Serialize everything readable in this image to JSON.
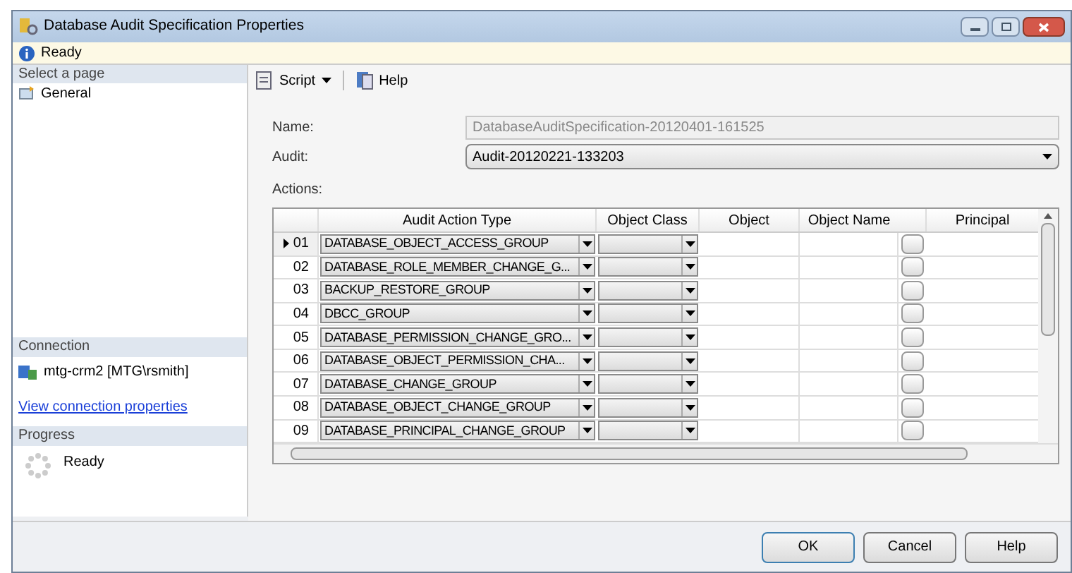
{
  "window": {
    "title": "Database Audit Specification Properties"
  },
  "status": {
    "text": "Ready"
  },
  "sidebar": {
    "heading": "Select a page",
    "items": [
      {
        "label": "General",
        "selected": false
      }
    ],
    "connection": {
      "heading": "Connection",
      "server": "mtg-crm2 [MTG\\rsmith]",
      "link": "View connection properties"
    },
    "progress": {
      "heading": "Progress",
      "text": "Ready"
    }
  },
  "toolbar": {
    "script": "Script",
    "help": "Help"
  },
  "form": {
    "name_label": "Name:",
    "name_value": "DatabaseAuditSpecification-20120401-161525",
    "audit_label": "Audit:",
    "audit_value": "Audit-20120221-133203",
    "actions_label": "Actions:"
  },
  "table": {
    "columns": [
      "Audit Action Type",
      "Object Class",
      "Object",
      "Object Name",
      "Principal"
    ],
    "rows": [
      {
        "number": "01",
        "action": "DATABASE_OBJECT_ACCESS_GROUP",
        "selected": true
      },
      {
        "number": "02",
        "action": "DATABASE_ROLE_MEMBER_CHANGE_G...",
        "selected": false
      },
      {
        "number": "03",
        "action": "BACKUP_RESTORE_GROUP",
        "selected": false
      },
      {
        "number": "04",
        "action": "DBCC_GROUP",
        "selected": false
      },
      {
        "number": "05",
        "action": "DATABASE_PERMISSION_CHANGE_GRO...",
        "selected": false
      },
      {
        "number": "06",
        "action": "DATABASE_OBJECT_PERMISSION_CHA...",
        "selected": false
      },
      {
        "number": "07",
        "action": "DATABASE_CHANGE_GROUP",
        "selected": false
      },
      {
        "number": "08",
        "action": "DATABASE_OBJECT_CHANGE_GROUP",
        "selected": false
      },
      {
        "number": "09",
        "action": "DATABASE_PRINCIPAL_CHANGE_GROUP",
        "selected": false
      }
    ]
  },
  "buttons": [
    "OK",
    "Cancel",
    "Help"
  ]
}
